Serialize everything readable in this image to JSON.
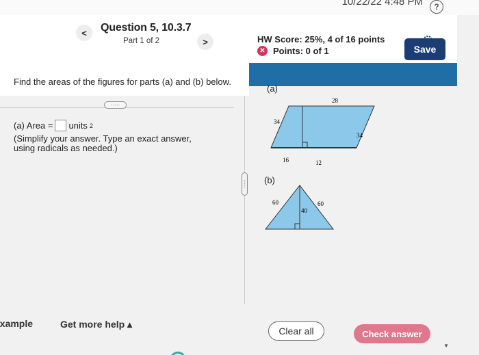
{
  "status": {
    "clock": "10/22/22 4:48 PM",
    "help_glyph": "?"
  },
  "header": {
    "prev_glyph": "<",
    "next_glyph": ">",
    "question_title": "Question 5, 10.3.7",
    "part": "Part 1 of 2",
    "hw_score": "HW Score: 25%, 4 of 16 points",
    "points": "Points: 0 of 1",
    "points_icon_glyph": "✕",
    "save_label": "Save"
  },
  "question": {
    "prompt": "Find the areas of the figures for parts (a) and (b) below.",
    "dots": "·····",
    "area_prefix": "(a) Area =",
    "area_unit": "units",
    "area_exp": "2",
    "instructions": "(Simplify your answer. Type an exact answer, using radicals as needed.)",
    "handle_dots": "·····"
  },
  "figures": {
    "a_label": "(a)",
    "b_label": "(b)",
    "a_top": "28",
    "a_left": "34",
    "a_right": "34",
    "a_bottom_left": "16",
    "a_bottom_right": "12",
    "b_left": "60",
    "b_right": "60",
    "b_height": "40",
    "fill_color": "#8cc8ea",
    "stroke_color": "#333333"
  },
  "footer": {
    "example_label": "example",
    "help_label": "Get more help ▴",
    "clear_label": "Clear all",
    "check_label": "Check answer",
    "scroll_glyph": "▼"
  }
}
